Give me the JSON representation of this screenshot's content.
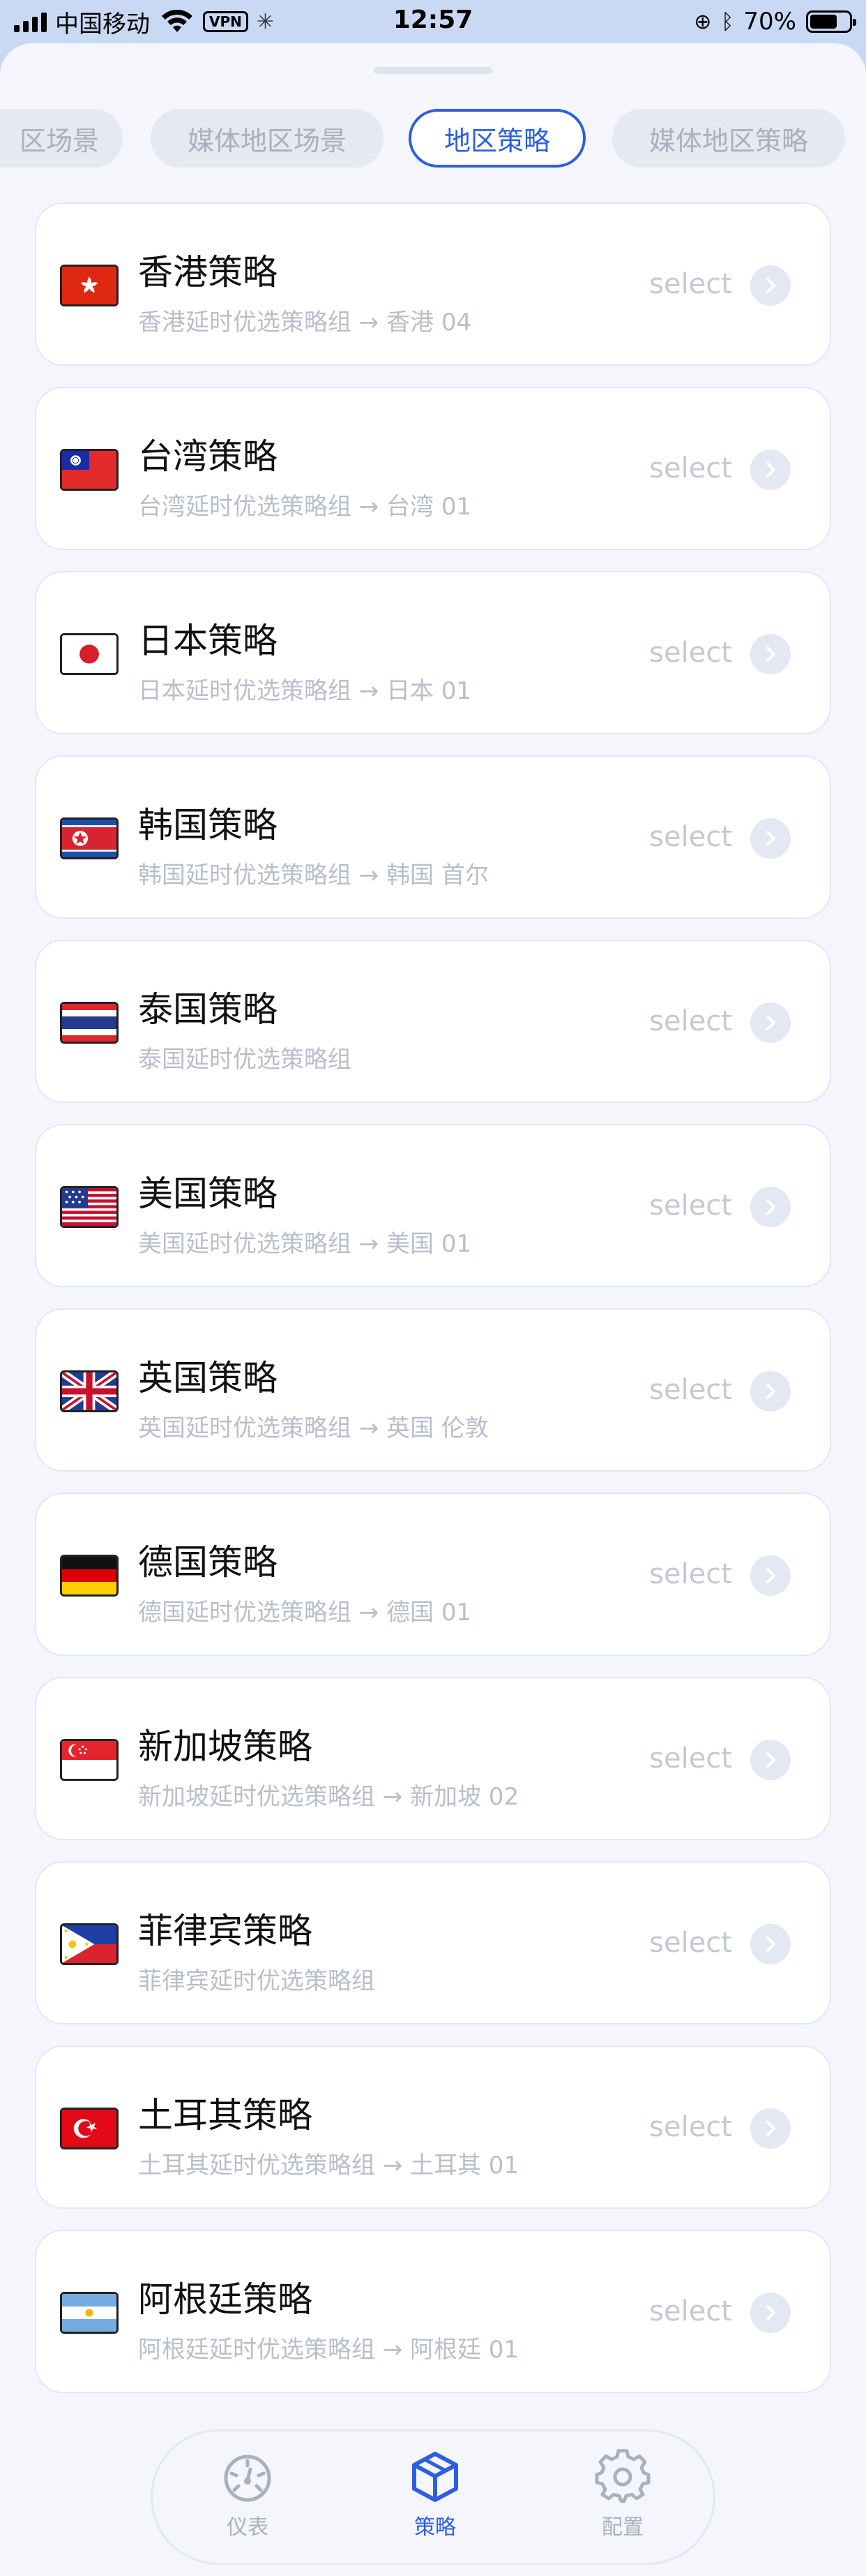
{
  "status_bar": {
    "carrier": "中国移动",
    "vpn": "VPN",
    "time": "12:57",
    "battery": "70%",
    "battery_level": 0.7
  },
  "tabs": [
    {
      "label": "区场景",
      "active": false
    },
    {
      "label": "媒体地区场景",
      "active": false
    },
    {
      "label": "地区策略",
      "active": true
    },
    {
      "label": "媒体地区策略",
      "active": false
    }
  ],
  "select_label": "select",
  "policies": [
    {
      "title": "香港策略",
      "subtitle": "香港延时优选策略组 → 香港 04",
      "flag": "hk-flag-icon"
    },
    {
      "title": "台湾策略",
      "subtitle": "台湾延时优选策略组 → 台湾 01",
      "flag": "tw-flag-icon"
    },
    {
      "title": "日本策略",
      "subtitle": "日本延时优选策略组 → 日本 01",
      "flag": "jp-flag-icon"
    },
    {
      "title": "韩国策略",
      "subtitle": "韩国延时优选策略组 → 韩国 首尔",
      "flag": "kp-flag-icon"
    },
    {
      "title": "泰国策略",
      "subtitle": "泰国延时优选策略组",
      "flag": "th-flag-icon"
    },
    {
      "title": "美国策略",
      "subtitle": "美国延时优选策略组 → 美国 01",
      "flag": "us-flag-icon"
    },
    {
      "title": "英国策略",
      "subtitle": "英国延时优选策略组 → 英国 伦敦",
      "flag": "uk-flag-icon"
    },
    {
      "title": "德国策略",
      "subtitle": "德国延时优选策略组 → 德国 01",
      "flag": "de-flag-icon"
    },
    {
      "title": "新加坡策略",
      "subtitle": "新加坡延时优选策略组 → 新加坡 02",
      "flag": "sg-flag-icon"
    },
    {
      "title": "菲律宾策略",
      "subtitle": "菲律宾延时优选策略组",
      "flag": "ph-flag-icon"
    },
    {
      "title": "土耳其策略",
      "subtitle": "土耳其延时优选策略组 → 土耳其 01",
      "flag": "tr-flag-icon"
    },
    {
      "title": "阿根廷策略",
      "subtitle": "阿根廷延时优选策略组 → 阿根廷 01",
      "flag": "ar-flag-icon"
    }
  ],
  "bottom_nav": [
    {
      "label": "仪表",
      "icon": "gauge-icon",
      "active": false
    },
    {
      "label": "策略",
      "icon": "cube-icon",
      "active": true
    },
    {
      "label": "配置",
      "icon": "gear-icon",
      "active": false
    }
  ],
  "colors": {
    "accent": "#2d5fe0",
    "inactive": "#a9b1bf"
  }
}
